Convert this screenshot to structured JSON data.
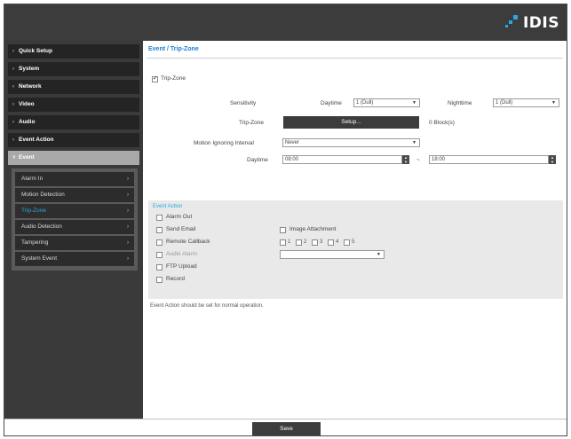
{
  "brand": {
    "logo_text": "IDIS"
  },
  "sidebar": {
    "menu_top": [
      {
        "label": "Quick Setup"
      },
      {
        "label": "System"
      },
      {
        "label": "Network"
      },
      {
        "label": "Video"
      },
      {
        "label": "Audio"
      },
      {
        "label": "Event Action"
      }
    ],
    "event_label": "Event",
    "event_items": [
      {
        "label": "Alarm In"
      },
      {
        "label": "Motion Detection"
      },
      {
        "label": "Trip-Zone"
      },
      {
        "label": "Audio Detection"
      },
      {
        "label": "Tampering"
      },
      {
        "label": "System Event"
      }
    ],
    "active_item": "Trip-Zone"
  },
  "main": {
    "breadcrumb": "Event / Trip-Zone",
    "trip_zone_enabled_label": "Trip-Zone",
    "trip_zone_enabled": true,
    "sensitivity_label": "Sensitivity",
    "daytime_label": "Daytime",
    "daytime_value": "1 (Dull)",
    "nighttime_label": "Nighttime",
    "nighttime_value": "1 (Dull)",
    "trip_zone_label": "Trip-Zone",
    "setup_button": "Setup...",
    "blocks_text": "0 Block(s)",
    "ignoring_label": "Motion Ignoring Interval",
    "ignoring_value": "Never",
    "daytime_range_label": "Daytime",
    "daytime_start": "08:00",
    "range_sep": "~",
    "daytime_end": "18:00"
  },
  "event_action": {
    "title": "Event Action",
    "alarm_out": "Alarm Out",
    "send_email": "Send Email",
    "image_attachment": "Image Attachment",
    "remote_callback": "Remote Callback",
    "callback_numbers": [
      "1",
      "2",
      "3",
      "4",
      "5"
    ],
    "audio_alarm": "Audio Alarm",
    "audio_alarm_value": "",
    "ftp_upload": "FTP Upload",
    "record": "Record"
  },
  "note": "Event Action should be set for normal operation.",
  "footer": {
    "save_label": "Save"
  }
}
